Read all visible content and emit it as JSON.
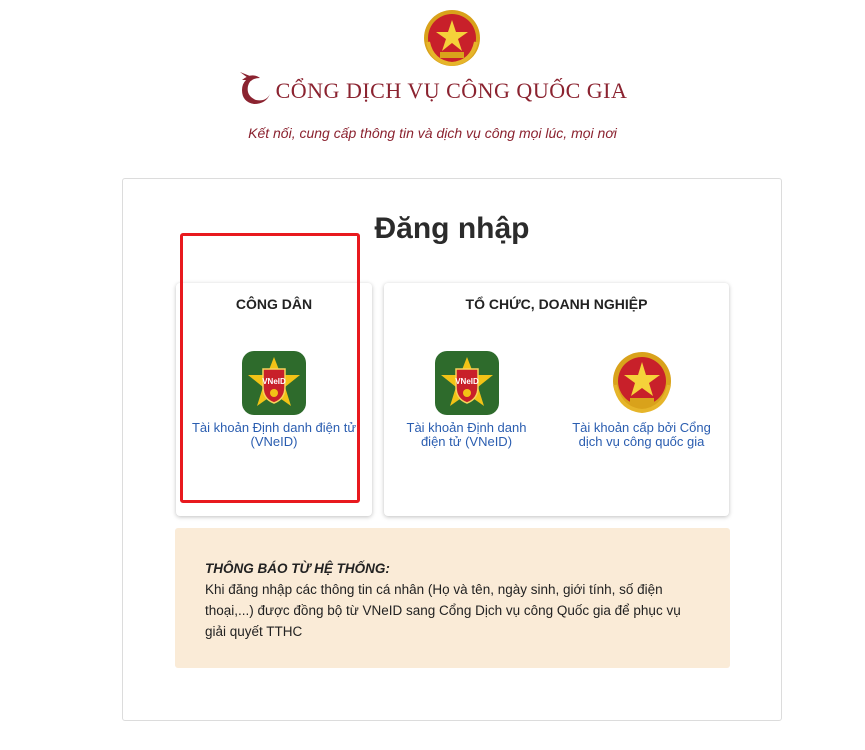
{
  "header": {
    "brand_title": "CỔNG DỊCH VỤ CÔNG QUỐC GIA",
    "tagline": "Kết nối, cung cấp thông tin và dịch vụ công mọi lúc, mọi nơi",
    "brand_color": "#8b2330"
  },
  "login": {
    "title": "Đăng nhập",
    "citizen": {
      "heading": "CÔNG DÂN",
      "options": [
        {
          "label": "Tài khoản Định danh điện tử (VNeID)",
          "icon": "vneid-icon"
        }
      ]
    },
    "organization": {
      "heading": "TỔ CHỨC, DOANH NGHIỆP",
      "options": [
        {
          "label": "Tài khoản Định danh điện tử (VNeID)",
          "icon": "vneid-icon"
        },
        {
          "label": "Tài khoản cấp bởi Cổng dịch vụ công quốc gia",
          "icon": "national-emblem-icon"
        }
      ]
    }
  },
  "notice": {
    "title": "THÔNG BÁO TỪ HỆ THỐNG:",
    "body": "Khi đăng nhập các thông tin cá nhân (Họ và tên, ngày sinh, giới tính, số điện thoại,...) được đồng bộ từ VNeID sang Cổng Dịch vụ công Quốc gia để phục vụ giải quyết TTHC",
    "background": "#faebd7"
  },
  "highlight_color": "#e8191e",
  "link_color": "#2a5db0"
}
